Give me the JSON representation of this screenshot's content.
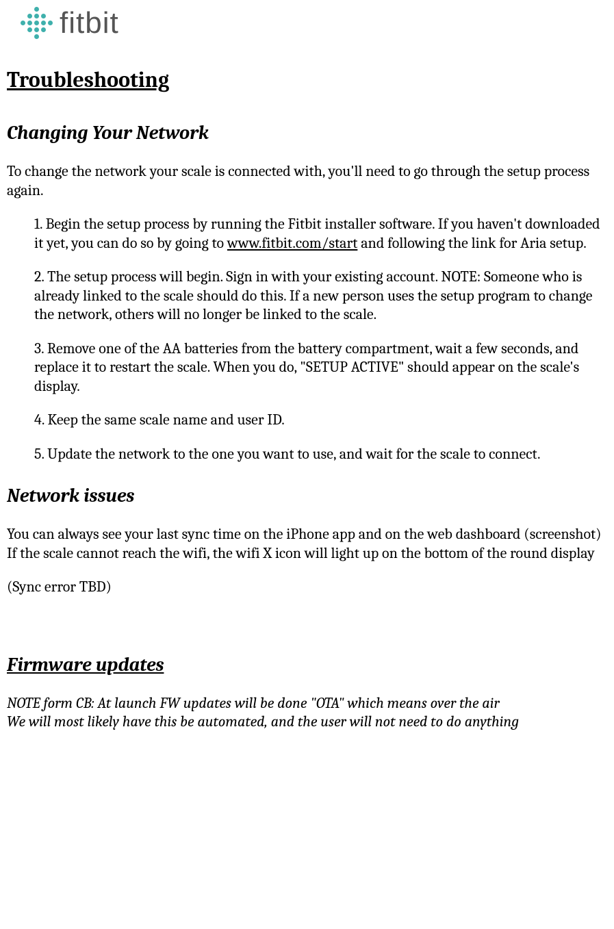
{
  "logo": {
    "text": "fitbit"
  },
  "h1": "Troubleshooting",
  "section1": {
    "heading": "Changing Your Network",
    "intro": "To change the network your scale is connected with, you'll need to go through the setup process again.",
    "step1_a": "1.    Begin the setup process by running the Fitbit installer software. If you haven't downloaded it yet, you can do so by going to ",
    "step1_link": "www.fitbit.com/start",
    "step1_b": " and following the link for Aria setup.",
    "step2": "2.    The setup process will begin. Sign in with your existing account. NOTE: Someone who is already linked to the scale should do this. If a new person uses the setup program to change the network, others will no longer be linked to the scale.",
    "step3": "3.    Remove one of the AA batteries from the battery compartment, wait a few seconds, and replace it to restart the scale. When you do, \"SETUP ACTIVE\" should appear on the scale's display.",
    "step4": "4.    Keep the same scale name and user ID.",
    "step5": "5.    Update the network to the one you want to use, and wait for the scale to connect."
  },
  "section2": {
    "heading": "Network issues",
    "p1": "You can always see your last sync time on the iPhone app and on the web dashboard (screenshot)",
    "p2": "If the scale cannot reach the wifi, the wifi X icon will light up on the bottom of the round display",
    "p3": "(Sync error TBD)"
  },
  "section3": {
    "heading": "Firmware updates",
    "note1": "NOTE form CB: At launch FW updates will be done \"OTA\" which means over the air",
    "note2": "We will most likely have this be automated, and the user will not need to do anything"
  }
}
